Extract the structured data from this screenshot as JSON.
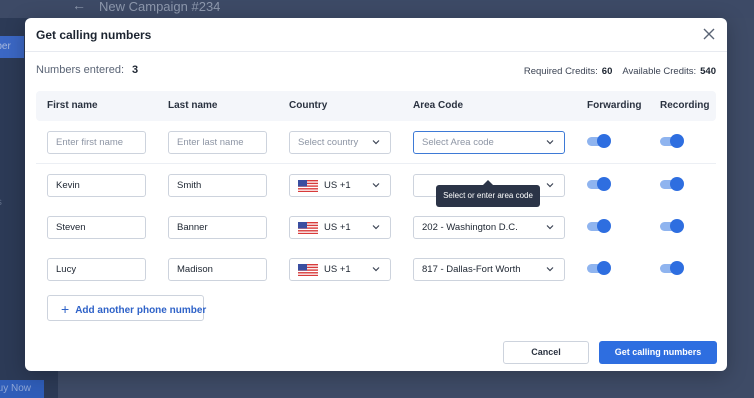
{
  "background": {
    "campaign_title": "New Campaign #234",
    "sidebar_chip": "mber",
    "sidebar_text": "ers",
    "buy_label": "Buy Now"
  },
  "modal": {
    "title": "Get calling numbers",
    "numbers_entered_label": "Numbers entered:",
    "numbers_entered_value": "3",
    "required_credits_label": "Required Credits:",
    "required_credits_value": "60",
    "available_credits_label": "Available Credits:",
    "available_credits_value": "540",
    "columns": [
      "First name",
      "Last name",
      "Country",
      "Area Code",
      "Forwarding",
      "Recording"
    ],
    "new_row": {
      "first_name_placeholder": "Enter first name",
      "last_name_placeholder": "Enter last name",
      "country_placeholder": "Select country",
      "area_placeholder": "Select Area code",
      "forwarding": true,
      "recording": true
    },
    "tooltip": "Select or enter area code",
    "rows": [
      {
        "first_name": "Kevin",
        "last_name": "Smith",
        "country": "US +1",
        "area": "",
        "forwarding": true,
        "recording": true
      },
      {
        "first_name": "Steven",
        "last_name": "Banner",
        "country": "US +1",
        "area": "202 - Washington D.C.",
        "forwarding": true,
        "recording": true
      },
      {
        "first_name": "Lucy",
        "last_name": "Madison",
        "country": "US +1",
        "area": "817 - Dallas-Fort Worth",
        "forwarding": true,
        "recording": true
      }
    ],
    "add_button": "Add another phone number",
    "cancel_button": "Cancel",
    "submit_button": "Get calling numbers"
  },
  "colors": {
    "accent": "#2e6ee0",
    "overlay": "#3c4964"
  }
}
